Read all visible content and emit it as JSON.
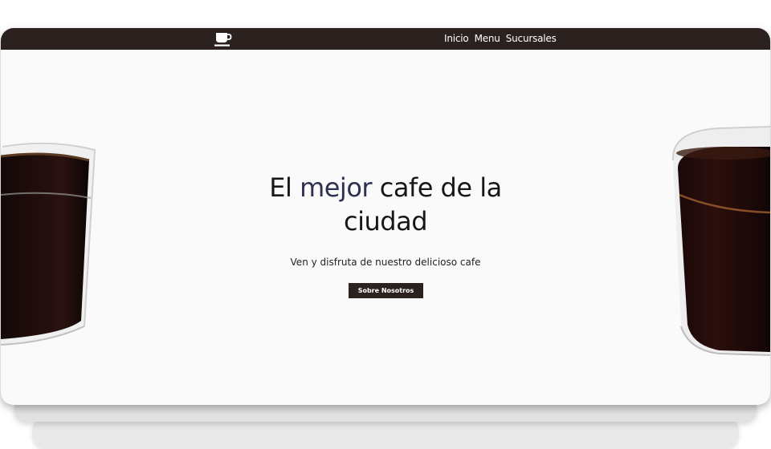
{
  "navbar": {
    "logo_icon": "coffee-cup-icon",
    "links": [
      {
        "label": "Inicio"
      },
      {
        "label": "Menu"
      },
      {
        "label": "Sucursales"
      }
    ]
  },
  "hero": {
    "title_before": "El ",
    "title_accent": "mejor",
    "title_after": " cafe de la",
    "title_line2": "ciudad",
    "subtitle": "Ven y disfruta de nuestro delicioso cafe",
    "button_label": "Sobre Nosotros"
  },
  "colors": {
    "navbar_bg": "#2b2220",
    "accent": "#2e3150",
    "background": "#fafafa",
    "button_bg": "#2b2220"
  }
}
